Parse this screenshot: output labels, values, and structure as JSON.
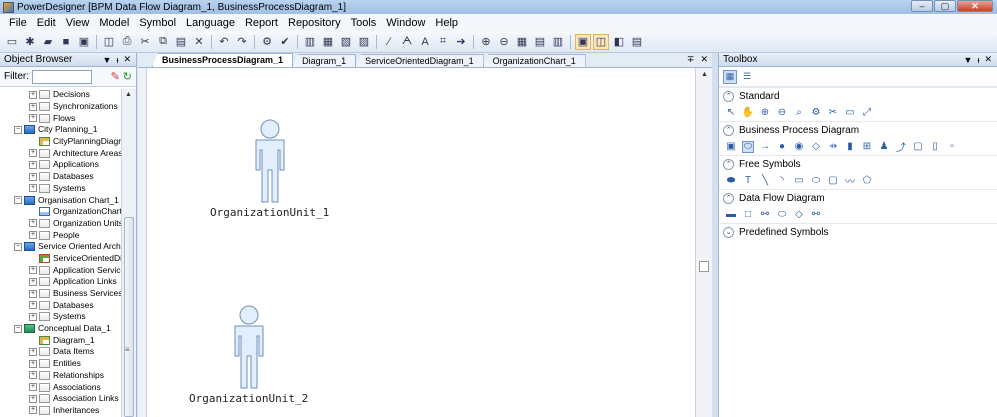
{
  "window": {
    "title": "PowerDesigner [BPM Data Flow Diagram_1, BusinessProcessDiagram_1]",
    "controls": [
      "–",
      "▢",
      "✕"
    ]
  },
  "menu": [
    "File",
    "Edit",
    "View",
    "Model",
    "Symbol",
    "Language",
    "Report",
    "Repository",
    "Tools",
    "Window",
    "Help"
  ],
  "toolbar": {
    "icons": [
      "new-icon",
      "open-icon",
      "folder-icon",
      "save-icon",
      "save-all-icon",
      "print-preview-icon",
      "print-icon",
      "cut-icon",
      "copy-icon",
      "paste-icon",
      "delete-icon",
      "undo-icon",
      "redo-icon",
      "properties-icon",
      "check-model-icon",
      "browser-toggle-icon",
      "output-toggle-icon",
      "result-list-icon",
      "toolbox-toggle-icon",
      "pen-icon",
      "format-icon",
      "font-icon",
      "link-icon",
      "arrow-icon",
      "zoom-in-icon",
      "zoom-out-icon",
      "grid-icon",
      "layout-icon",
      "align-icon",
      "view-mode-icon",
      "full-page-icon",
      "report-icon",
      "print-diagram-icon"
    ]
  },
  "object_browser": {
    "title": "Object Browser",
    "controls": [
      "▼",
      "ᵼ",
      "✕"
    ],
    "filter_label": "Filter:",
    "filter_value": "",
    "items": [
      {
        "label": "Decisions",
        "indent": 2,
        "exp": "+",
        "icon": "folder"
      },
      {
        "label": "Synchronizations",
        "indent": 2,
        "exp": "+",
        "icon": "folder"
      },
      {
        "label": "Flows",
        "indent": 2,
        "exp": "+",
        "icon": "folder"
      },
      {
        "label": "City Planning_1",
        "indent": 1,
        "exp": "−",
        "icon": "model"
      },
      {
        "label": "CityPlanningDiagra",
        "indent": 2,
        "exp": "",
        "icon": "diagram"
      },
      {
        "label": "Architecture Areas",
        "indent": 2,
        "exp": "+",
        "icon": "folder"
      },
      {
        "label": "Applications",
        "indent": 2,
        "exp": "+",
        "icon": "folder"
      },
      {
        "label": "Databases",
        "indent": 2,
        "exp": "+",
        "icon": "folder"
      },
      {
        "label": "Systems",
        "indent": 2,
        "exp": "+",
        "icon": "folder"
      },
      {
        "label": "Organisation Chart_1",
        "indent": 1,
        "exp": "−",
        "icon": "model"
      },
      {
        "label": "OrganizationChart_",
        "indent": 2,
        "exp": "",
        "icon": "org"
      },
      {
        "label": "Organization Units",
        "indent": 2,
        "exp": "+",
        "icon": "folder"
      },
      {
        "label": "People",
        "indent": 2,
        "exp": "+",
        "icon": "folder"
      },
      {
        "label": "Service Oriented Archit",
        "indent": 1,
        "exp": "−",
        "icon": "model"
      },
      {
        "label": "ServiceOrientedDi",
        "indent": 2,
        "exp": "",
        "icon": "soa"
      },
      {
        "label": "Application Service",
        "indent": 2,
        "exp": "+",
        "icon": "folder"
      },
      {
        "label": "Application Links",
        "indent": 2,
        "exp": "+",
        "icon": "folder"
      },
      {
        "label": "Business Services",
        "indent": 2,
        "exp": "+",
        "icon": "folder"
      },
      {
        "label": "Databases",
        "indent": 2,
        "exp": "+",
        "icon": "folder"
      },
      {
        "label": "Systems",
        "indent": 2,
        "exp": "+",
        "icon": "folder"
      },
      {
        "label": "Conceptual Data_1",
        "indent": 1,
        "exp": "−",
        "icon": "cdm"
      },
      {
        "label": "Diagram_1",
        "indent": 2,
        "exp": "",
        "icon": "diagram"
      },
      {
        "label": "Data Items",
        "indent": 2,
        "exp": "+",
        "icon": "folder"
      },
      {
        "label": "Entities",
        "indent": 2,
        "exp": "+",
        "icon": "folder"
      },
      {
        "label": "Relationships",
        "indent": 2,
        "exp": "+",
        "icon": "folder"
      },
      {
        "label": "Associations",
        "indent": 2,
        "exp": "+",
        "icon": "folder"
      },
      {
        "label": "Association Links",
        "indent": 2,
        "exp": "+",
        "icon": "folder"
      },
      {
        "label": "Inheritances",
        "indent": 2,
        "exp": "+",
        "icon": "folder"
      }
    ]
  },
  "tabs": {
    "items": [
      "BusinessProcessDiagram_1",
      "Diagram_1",
      "ServiceOrientedDiagram_1",
      "OrganizationChart_1"
    ],
    "active": 0,
    "controls": [
      "∓",
      "✕"
    ]
  },
  "canvas": {
    "objects": [
      {
        "label": "OrganizationUnit_1"
      },
      {
        "label": "OrganizationUnit_2"
      }
    ]
  },
  "toolbox": {
    "title": "Toolbox",
    "controls": [
      "▼",
      "ᵼ",
      "✕"
    ],
    "view_icons": [
      "large-icons-view-icon",
      "list-view-icon"
    ],
    "groups": [
      {
        "name": "Standard",
        "expanded": true,
        "tools": [
          "pointer-icon",
          "grabber-icon",
          "zoom-in-icon",
          "zoom-out-icon",
          "open-diagram-icon",
          "properties-icon",
          "delete-icon",
          "package-icon",
          "link-icon"
        ]
      },
      {
        "name": "Business Process Diagram",
        "expanded": true,
        "tools": [
          "process-icon",
          "start-icon",
          "flow-icon",
          "end-icon",
          "decision-icon",
          "sync-icon",
          "resource-icon",
          "organization-unit-icon",
          "role-icon",
          "swimlane-icon",
          "message-format-icon",
          "data-icon",
          "document-icon",
          "file-icon"
        ]
      },
      {
        "name": "Free Symbols",
        "expanded": true,
        "tools": [
          "note-icon",
          "text-icon",
          "line-icon",
          "arc-icon",
          "rectangle-icon",
          "ellipse-icon",
          "rounded-rect-icon",
          "polyline-icon",
          "polygon-icon"
        ]
      },
      {
        "name": "Data Flow Diagram",
        "expanded": true,
        "tools": [
          "dfd-process-icon",
          "external-entity-icon",
          "data-store-icon",
          "data-flow-icon",
          "dfd-split-icon",
          "dfd-join-icon"
        ]
      },
      {
        "name": "Predefined Symbols",
        "expanded": false,
        "tools": []
      }
    ]
  }
}
